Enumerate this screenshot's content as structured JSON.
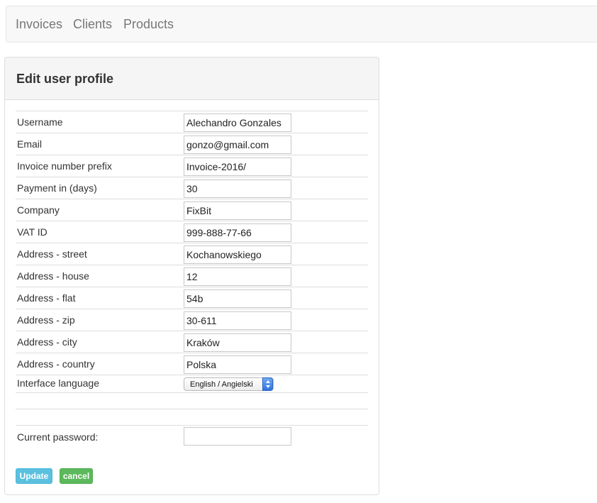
{
  "nav": {
    "items": [
      {
        "label": "Invoices"
      },
      {
        "label": "Clients"
      },
      {
        "label": "Products"
      }
    ]
  },
  "panel": {
    "title": "Edit user profile"
  },
  "form": {
    "fields": [
      {
        "label": "Username",
        "value": "Alechandro Gonzales"
      },
      {
        "label": "Email",
        "value": "gonzo@gmail.com"
      },
      {
        "label": "Invoice number prefix",
        "value": "Invoice-2016/"
      },
      {
        "label": "Payment in (days)",
        "value": "30"
      },
      {
        "label": "Company",
        "value": "FixBit"
      },
      {
        "label": "VAT ID",
        "value": "999-888-77-66"
      },
      {
        "label": "Address - street",
        "value": "Kochanowskiego"
      },
      {
        "label": "Address - house",
        "value": "12"
      },
      {
        "label": "Address - flat",
        "value": "54b"
      },
      {
        "label": "Address - zip",
        "value": "30-611"
      },
      {
        "label": "Address - city",
        "value": "Kraków"
      },
      {
        "label": "Address - country",
        "value": "Polska"
      }
    ],
    "language": {
      "label": "Interface language",
      "selected": "English / Angielski"
    },
    "password": {
      "label": "Current password:",
      "value": ""
    }
  },
  "buttons": {
    "update_label": "Update",
    "cancel_label": "cancel"
  },
  "colors": {
    "update_button": "#5bc0de",
    "cancel_button": "#5cb85c",
    "select_arrow": "#3b82ea"
  }
}
